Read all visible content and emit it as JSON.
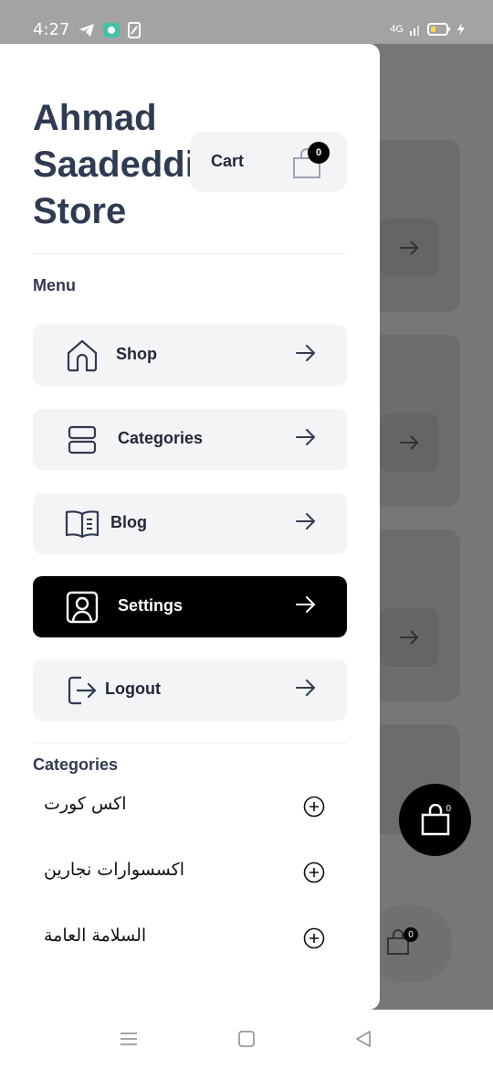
{
  "status_bar": {
    "time": "4:27",
    "network": "4G",
    "icons_left": [
      "telegram-icon",
      "chat-icon",
      "sim-icon"
    ],
    "icons_right": [
      "signal-icon",
      "battery-icon",
      "charging-icon"
    ]
  },
  "drawer": {
    "store_title": "Ahmad Saadeddin Store",
    "cart": {
      "label": "Cart",
      "count": "0"
    },
    "menu_heading": "Menu",
    "menu_items": [
      {
        "label": "Shop",
        "icon": "home-icon",
        "active": false
      },
      {
        "label": "Categories",
        "icon": "categories-icon",
        "active": false
      },
      {
        "label": "Blog",
        "icon": "book-icon",
        "active": false
      },
      {
        "label": "Settings",
        "icon": "user-icon",
        "active": true
      },
      {
        "label": "Logout",
        "icon": "logout-icon",
        "active": false
      }
    ],
    "categories_heading": "Categories",
    "categories": [
      {
        "label": "اكس كورت"
      },
      {
        "label": "اكسسوارات نجارين"
      },
      {
        "label": "السلامة العامة"
      }
    ]
  },
  "background": {
    "floating_cart_count": "0",
    "bottom_cart_count": "0"
  },
  "colors": {
    "active_item_bg": "#000000",
    "item_bg": "#f3f4f6",
    "title_color": "#2f3b52",
    "overlay": "#777777"
  }
}
